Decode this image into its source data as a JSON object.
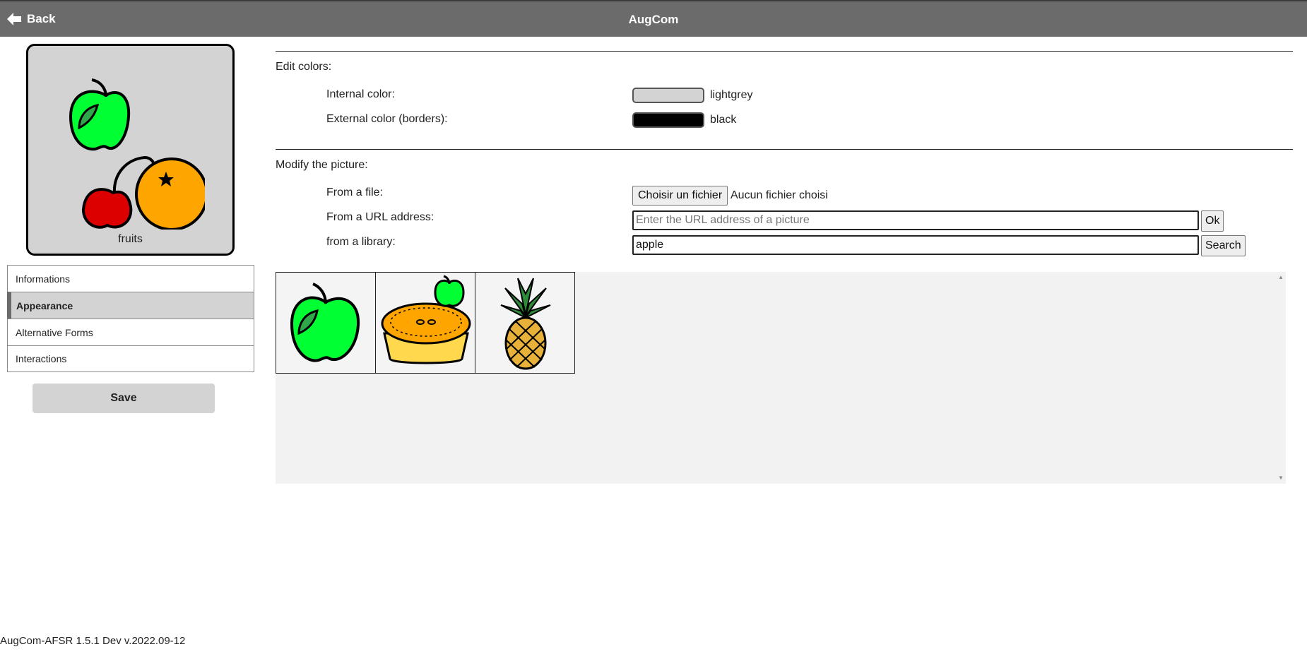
{
  "header": {
    "back_label": "Back",
    "title": "AugCom"
  },
  "preview": {
    "label": "fruits"
  },
  "tabs": [
    {
      "label": "Informations"
    },
    {
      "label": "Appearance"
    },
    {
      "label": "Alternative Forms"
    },
    {
      "label": "Interactions"
    }
  ],
  "save_label": "Save",
  "colors_section": {
    "title": "Edit colors:",
    "internal_label": "Internal color:",
    "internal_value": "lightgrey",
    "internal_hex": "#d3d3d3",
    "external_label": "External color (borders):",
    "external_value": "black",
    "external_hex": "#000000"
  },
  "picture_section": {
    "title": "Modify the picture:",
    "file_label": "From a file:",
    "file_button": "Choisir un fichier",
    "file_status": "Aucun fichier choisi",
    "url_label": "From a URL address:",
    "url_placeholder": "Enter the URL address of a picture",
    "url_button": "Ok",
    "library_label": "from a library:",
    "library_value": "apple",
    "library_button": "Search"
  },
  "results": [
    {
      "icon": "apple-icon"
    },
    {
      "icon": "apple-pie-icon"
    },
    {
      "icon": "pineapple-icon"
    }
  ],
  "footer": "AugCom-AFSR 1.5.1 Dev v.2022.09-12"
}
